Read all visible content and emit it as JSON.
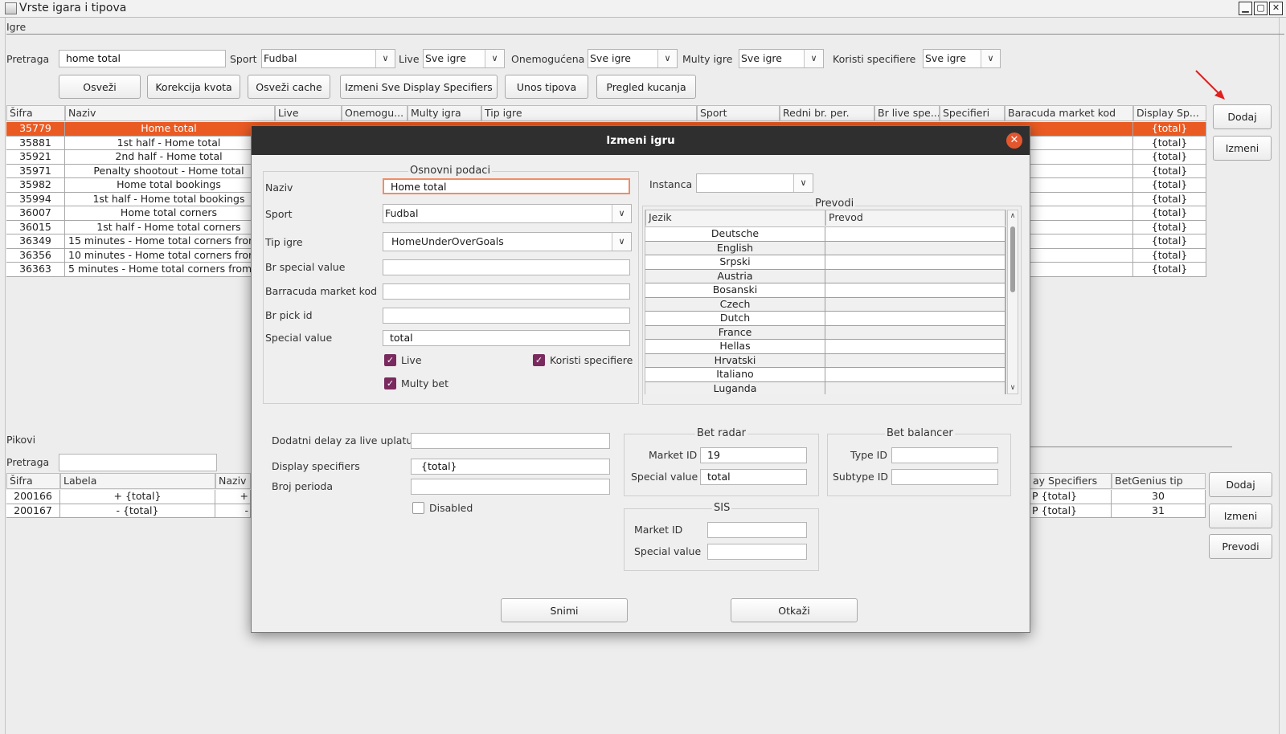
{
  "window": {
    "title": "Vrste igara i tipova",
    "buttons": [
      "▁",
      "▢",
      "✕"
    ]
  },
  "igre": {
    "section_label": "Igre",
    "search_label": "Pretraga",
    "search_value": "home total",
    "filters": {
      "sport_label": "Sport",
      "sport_value": "Fudbal",
      "live_label": "Live",
      "live_value": "Sve igre",
      "onemogucena_label": "Onemogućena",
      "onemogucena_value": "Sve igre",
      "multy_label": "Multy igre",
      "multy_value": "Sve igre",
      "koristi_label": "Koristi specifiere",
      "koristi_value": "Sve igre"
    },
    "toolbar": {
      "osvezi": "Osveži",
      "korekcija": "Korekcija kvota",
      "osvezi_cache": "Osveži cache",
      "izmeni_display": "Izmeni Sve Display Specifiers",
      "unos_tipova": "Unos tipova",
      "pregled": "Pregled kucanja"
    },
    "columns": [
      "Šifra",
      "Naziv",
      "Live",
      "Onemogu...",
      "Multy igra",
      "Tip igre",
      "Sport",
      "Redni br. per.",
      "Br live spe...",
      "Specifieri",
      "Baracuda market kod",
      "Display Sp..."
    ],
    "rows": [
      {
        "sifra": "35779",
        "naziv": "Home total",
        "display": "{total}"
      },
      {
        "sifra": "35881",
        "naziv": "1st half - Home total",
        "display": "{total}"
      },
      {
        "sifra": "35921",
        "naziv": "2nd half - Home total",
        "display": "{total}"
      },
      {
        "sifra": "35971",
        "naziv": "Penalty shootout - Home total",
        "display": "{total}"
      },
      {
        "sifra": "35982",
        "naziv": "Home total bookings",
        "display": "{total}"
      },
      {
        "sifra": "35994",
        "naziv": "1st half - Home total bookings",
        "display": "{total}"
      },
      {
        "sifra": "36007",
        "naziv": "Home total corners",
        "display": "{total}"
      },
      {
        "sifra": "36015",
        "naziv": "1st half - Home total corners",
        "display": "{total}"
      },
      {
        "sifra": "36349",
        "naziv": "15 minutes - Home total corners from",
        "display": "{total}"
      },
      {
        "sifra": "36356",
        "naziv": "10 minutes - Home total corners from",
        "display": "{total}"
      },
      {
        "sifra": "36363",
        "naziv": "5 minutes - Home total corners from",
        "display": "{total}"
      }
    ],
    "side_buttons": {
      "dodaj": "Dodaj",
      "izmeni": "Izmeni"
    }
  },
  "pikovi": {
    "section_label": "Pikovi",
    "search_label": "Pretraga",
    "search_value": "",
    "columns": [
      "Šifra",
      "Labela",
      "Naziv",
      "ay Specifiers",
      "BetGenius tip"
    ],
    "rows": [
      {
        "sifra": "200166",
        "labela": "+ {total}",
        "naziv": "+",
        "spec": "P {total}",
        "bg": "30"
      },
      {
        "sifra": "200167",
        "labela": "- {total}",
        "naziv": "-",
        "spec": "P {total}",
        "bg": "31"
      }
    ],
    "side_buttons": {
      "dodaj": "Dodaj",
      "izmeni": "Izmeni",
      "prevodi": "Prevodi"
    }
  },
  "dialog": {
    "title": "Izmeni igru",
    "osnovni": {
      "title": "Osnovni podaci",
      "naziv_label": "Naziv",
      "naziv_value": "Home total",
      "sport_label": "Sport",
      "sport_value": "Fudbal",
      "tip_label": "Tip igre",
      "tip_value": "HomeUnderOverGoals",
      "br_special_label": "Br special value",
      "br_special_value": "",
      "barracuda_label": "Barracuda market kod",
      "barracuda_value": "",
      "br_pick_label": "Br pick id",
      "br_pick_value": "",
      "special_label": "Special value",
      "special_value": "total",
      "live_label": "Live",
      "koristi_label": "Koristi specifiere",
      "multy_label": "Multy bet"
    },
    "instanca_label": "Instanca",
    "instanca_value": "",
    "prevodi": {
      "title": "Prevodi",
      "col_jezik": "Jezik",
      "col_prevod": "Prevod",
      "languages": [
        "Deutsche",
        "English",
        "Srpski",
        "Austria",
        "Bosanski",
        "Czech",
        "Dutch",
        "France",
        "Hellas",
        "Hrvatski",
        "Italiano",
        "Luganda"
      ]
    },
    "dodatni_label": "Dodatni delay za live uplatu",
    "dodatni_value": "",
    "display_label": "Display specifiers",
    "display_value": "{total}",
    "broj_perioda_label": "Broj perioda",
    "broj_perioda_value": "",
    "disabled_label": "Disabled",
    "bet_radar": {
      "title": "Bet radar",
      "market_label": "Market ID",
      "market_value": "19",
      "special_label": "Special value",
      "special_value": "total"
    },
    "bet_balancer": {
      "title": "Bet balancer",
      "type_label": "Type ID",
      "type_value": "",
      "subtype_label": "Subtype ID",
      "subtype_value": ""
    },
    "sis": {
      "title": "SIS",
      "market_label": "Market ID",
      "market_value": "",
      "special_label": "Special value",
      "special_value": ""
    },
    "snimi": "Snimi",
    "otkazi": "Otkaži"
  },
  "annotation": {
    "color": "#e02020"
  },
  "colors": {
    "selection": "#ea5b23",
    "dialog_header": "#2f2f2f",
    "checkbox": "#7a2a5f",
    "close": "#e4572e"
  }
}
